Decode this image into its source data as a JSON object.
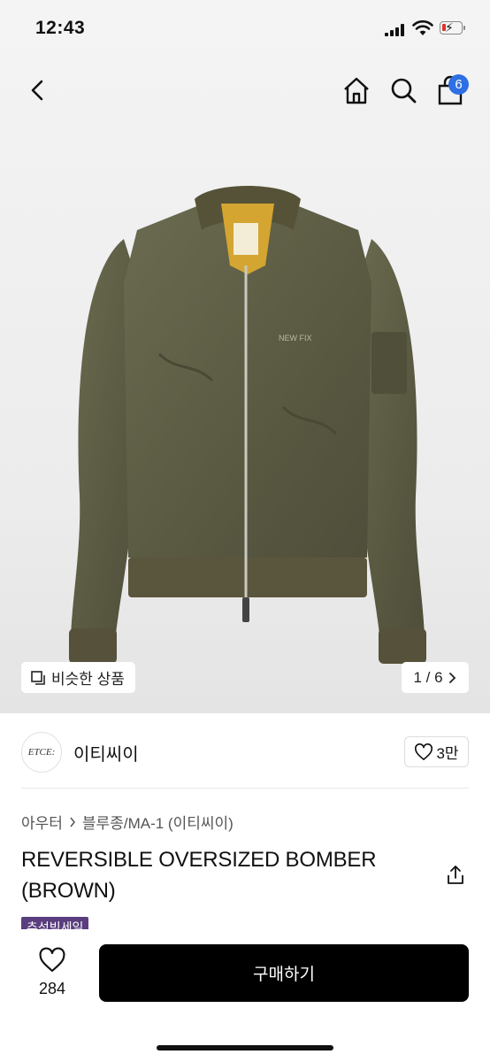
{
  "status_bar": {
    "time": "12:43"
  },
  "nav": {
    "cart_count": "6"
  },
  "gallery": {
    "similar_label": "비슷한 상품",
    "counter": "1 / 6",
    "image_icon": "olive-bomber-jacket"
  },
  "brand": {
    "logo_text": "ETCE:",
    "name": "이티씨이",
    "like_count": "3만"
  },
  "breadcrumb": {
    "category": "아우터",
    "subcategory": "블루종/MA-1 (이티씨이)"
  },
  "product": {
    "title": "REVERSIBLE OVERSIZED BOMBER (BROWN)",
    "sale_badge": "추석빅세일"
  },
  "bottom_bar": {
    "wish_count": "284",
    "buy_label": "구매하기"
  },
  "colors": {
    "accent_badge": "#2f6fe4",
    "buy_button": "#000000",
    "sale_badge": "#5a3e7e",
    "jacket": "#5f5f47"
  }
}
